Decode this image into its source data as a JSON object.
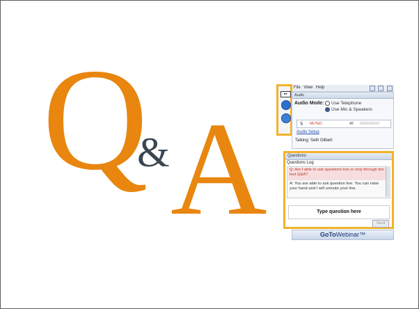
{
  "slide": {
    "q": "Q",
    "amp": "&",
    "a": "A"
  },
  "gtw": {
    "menu": [
      "File",
      "View",
      "Help"
    ],
    "collapse_label": "▸▸",
    "audio": {
      "header": "Audio",
      "mode_label": "Audio Mode:",
      "option1": "Use Telephone",
      "option2": "Use Mic & Speakers",
      "selected": "Use Mic & Speakers",
      "mic_label": "MUTED",
      "speaker_label": "40",
      "speaker_level": "0000000000",
      "setup_link": "Audio Setup",
      "talking": "Talking: Seth Gilbert"
    },
    "questions": {
      "header": "Questions",
      "log_label": "Questions Log",
      "q_text": "Q: Am I able to ask questions live or only through the text Q&A?",
      "a_text": "A: You are able to ask question live. You can raise your hand and I will unmute your line.",
      "input_text": "Type question here",
      "send_label": "Send"
    },
    "footer": {
      "brand_bold": "GoTo",
      "brand_rest": "Webinar™"
    },
    "colors": {
      "accent": "#e8860f",
      "highlight_border": "#f2b22a",
      "amp": "#3a4650"
    }
  }
}
